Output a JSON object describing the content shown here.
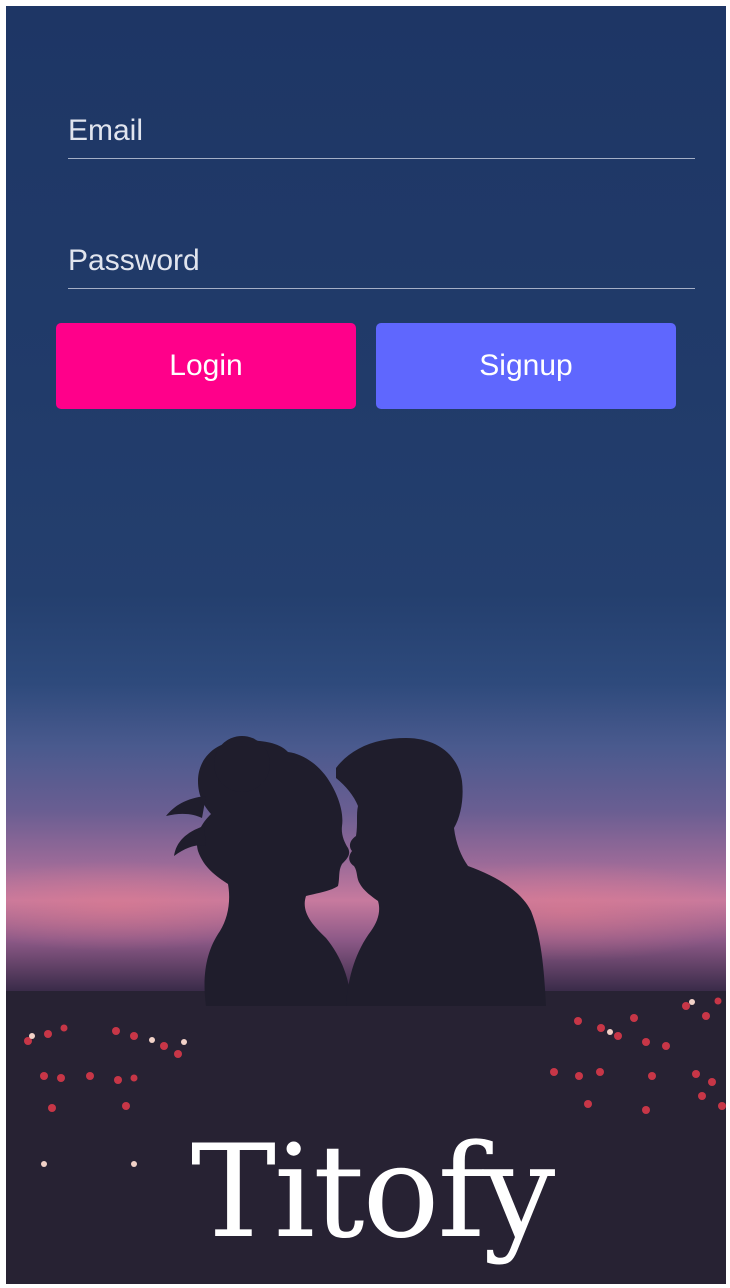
{
  "login_form": {
    "email_placeholder": "Email",
    "password_placeholder": "Password",
    "login_label": "Login",
    "signup_label": "Signup"
  },
  "brand": {
    "app_name": "Titofy"
  },
  "colors": {
    "login_button": "#ff008a",
    "signup_button": "#5f67fe",
    "sky_top": "#1e3665",
    "horizon_pink": "#c77a9e",
    "ground": "#262233"
  },
  "background_image": {
    "icon": "couple-silhouette-image"
  }
}
